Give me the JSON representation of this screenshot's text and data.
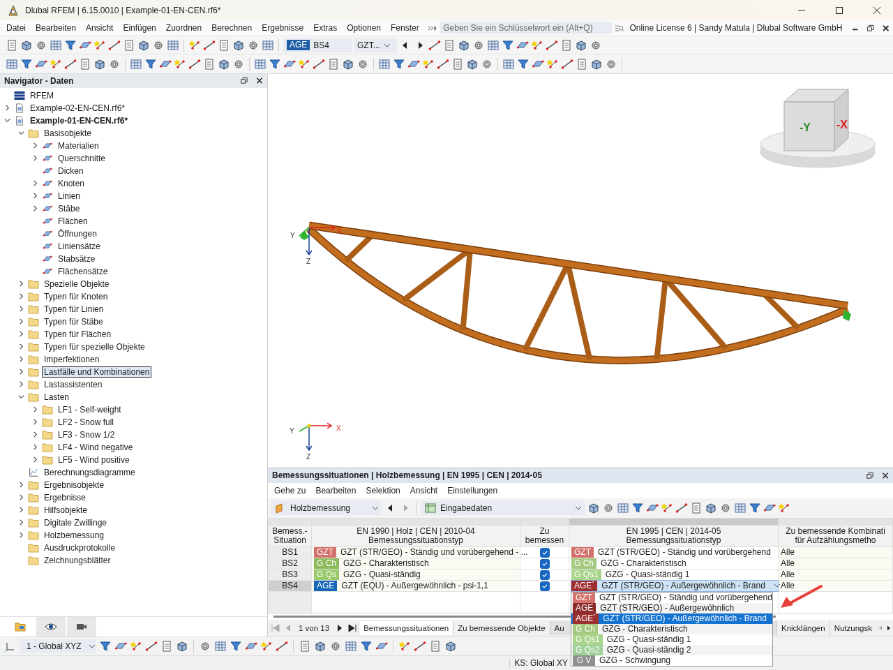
{
  "window": {
    "title": "Dlubal RFEM | 6.15.0010 | Example-01-EN-CEN.rf6*"
  },
  "menu": [
    "Datei",
    "Bearbeiten",
    "Ansicht",
    "Einfügen",
    "Zuordnen",
    "Berechnen",
    "Ergebnisse",
    "Extras",
    "Optionen",
    "Fenster"
  ],
  "search": {
    "placeholder": "Geben Sie ein Schlüsselwort ein (Alt+Q)"
  },
  "license": "Online License 6 | Sandy Matula | Dlubal Software GmbH",
  "toolbar": {
    "situation_badge": {
      "label": "AGE",
      "color": "#1e5fa8"
    },
    "situation": "BS4",
    "combo": "GZT..."
  },
  "navigator": {
    "title": "Navigator - Daten",
    "tree": [
      {
        "label": "RFEM",
        "kind": "root",
        "selected": false
      },
      {
        "label": "Example-02-EN-CEN.rf6*",
        "kind": "file",
        "expanded": false,
        "selected": false
      },
      {
        "label": "Example-01-EN-CEN.rf6*",
        "kind": "file",
        "expanded": true,
        "selected": false,
        "children": [
          {
            "label": "Basisobjekte",
            "kind": "folder",
            "expanded": true,
            "selected": false,
            "children": [
              {
                "label": "Materialien",
                "kind": "object",
                "expanded": false,
                "selected": false
              },
              {
                "label": "Querschnitte",
                "kind": "object",
                "expanded": false,
                "selected": false
              },
              {
                "label": "Dicken",
                "kind": "object",
                "selected": false
              },
              {
                "label": "Knoten",
                "kind": "object",
                "expanded": false,
                "selected": false
              },
              {
                "label": "Linien",
                "kind": "object",
                "expanded": false,
                "selected": false
              },
              {
                "label": "Stäbe",
                "kind": "object",
                "expanded": false,
                "selected": false
              },
              {
                "label": "Flächen",
                "kind": "object",
                "selected": false
              },
              {
                "label": "Öffnungen",
                "kind": "object",
                "selected": false
              },
              {
                "label": "Liniensätze",
                "kind": "object",
                "selected": false
              },
              {
                "label": "Stabsätze",
                "kind": "object",
                "selected": false
              },
              {
                "label": "Flächensätze",
                "kind": "object",
                "selected": false
              }
            ]
          },
          {
            "label": "Spezielle Objekte",
            "kind": "folder",
            "expanded": false,
            "selected": false
          },
          {
            "label": "Typen für Knoten",
            "kind": "folder",
            "expanded": false,
            "selected": false
          },
          {
            "label": "Typen für Linien",
            "kind": "folder",
            "expanded": false,
            "selected": false
          },
          {
            "label": "Typen für Stäbe",
            "kind": "folder",
            "expanded": false,
            "selected": false
          },
          {
            "label": "Typen für Flächen",
            "kind": "folder",
            "expanded": false,
            "selected": false
          },
          {
            "label": "Typen für spezielle Objekte",
            "kind": "folder",
            "expanded": false,
            "selected": false
          },
          {
            "label": "Imperfektionen",
            "kind": "folder",
            "expanded": false,
            "selected": false
          },
          {
            "label": "Lastfälle und Kombinationen",
            "kind": "folder",
            "expanded": false,
            "selected": true
          },
          {
            "label": "Lastassistenten",
            "kind": "folder",
            "expanded": false,
            "selected": false
          },
          {
            "label": "Lasten",
            "kind": "folder",
            "expanded": true,
            "selected": false,
            "children": [
              {
                "label": "LF1 - Self-weight",
                "kind": "folder",
                "expanded": false,
                "selected": false
              },
              {
                "label": "LF2 - Snow full",
                "kind": "folder",
                "expanded": false,
                "selected": false
              },
              {
                "label": "LF3 - Snow 1/2",
                "kind": "folder",
                "expanded": false,
                "selected": false
              },
              {
                "label": "LF4 - Wind negative",
                "kind": "folder",
                "expanded": false,
                "selected": false
              },
              {
                "label": "LF5 - Wind positive",
                "kind": "folder",
                "expanded": false,
                "selected": false
              }
            ]
          },
          {
            "label": "Berechnungsdiagramme",
            "kind": "diagram",
            "selected": false
          },
          {
            "label": "Ergebnisobjekte",
            "kind": "folder",
            "expanded": false,
            "selected": false
          },
          {
            "label": "Ergebnisse",
            "kind": "folder",
            "expanded": false,
            "selected": false
          },
          {
            "label": "Hilfsobjekte",
            "kind": "folder",
            "expanded": false,
            "selected": false
          },
          {
            "label": "Digitale Zwillinge",
            "kind": "folder",
            "expanded": false,
            "selected": false
          },
          {
            "label": "Holzbemessung",
            "kind": "folder",
            "expanded": false,
            "selected": false
          },
          {
            "label": "Ausdruckprotokolle",
            "kind": "folder",
            "selected": false
          },
          {
            "label": "Zeichnungsblätter",
            "kind": "folder",
            "selected": false
          }
        ]
      }
    ],
    "tabs": [
      {
        "selected": true
      },
      {
        "selected": false
      },
      {
        "selected": false
      }
    ]
  },
  "viewport": {
    "axes_main": [
      "Y",
      "X",
      "Z"
    ],
    "axes_corner": [
      "Y",
      "X",
      "Z"
    ],
    "view_cube": [
      "-Y",
      "-X"
    ]
  },
  "panel": {
    "title": "Bemessungssituationen | Holzbemessung | EN 1995 | CEN | 2014-05",
    "menu": [
      "Gehe zu",
      "Bearbeiten",
      "Selektion",
      "Ansicht",
      "Einstellungen"
    ],
    "module_combo": "Holzbemessung",
    "data_combo": "Eingabedaten",
    "columns": [
      {
        "lines": [
          "Bemess.-",
          "Situation"
        ]
      },
      {
        "lines": [
          "EN 1990 | Holz | CEN | 2010-04",
          "Bemessungssituationstyp"
        ]
      },
      {
        "lines": [
          "Zu",
          "bemessen"
        ]
      },
      {
        "lines": [
          "EN 1995 | CEN | 2014-05",
          "Bemessungssituationstyp"
        ]
      },
      {
        "lines": [
          "Zu bemessende Kombinati",
          "für Aufzählungsmetho"
        ]
      }
    ],
    "rows": [
      {
        "id": "BS1",
        "selected": false,
        "en1990": {
          "badge": "GZT",
          "color": "#d4716b",
          "text": "GZT (STR/GEO) - Ständig und vorübergehend - ..."
        },
        "design": true,
        "en1995": {
          "badge": "GZT",
          "color": "#d4716b",
          "text": "GZT (STR/GEO) - Ständig und vorübergehend",
          "editing": false
        },
        "combos": "Alle"
      },
      {
        "id": "BS2",
        "selected": false,
        "en1990": {
          "badge": "G Ch",
          "color": "#8dbb5c",
          "text": "GZG - Charakteristisch"
        },
        "design": true,
        "en1995": {
          "badge": "G Ch",
          "color": "#a5c97f",
          "text": "GZG - Charakteristisch",
          "editing": false
        },
        "combos": "Alle"
      },
      {
        "id": "BS3",
        "selected": false,
        "en1990": {
          "badge": "G Qs",
          "color": "#98c96a",
          "text": "GZG - Quasi-ständig"
        },
        "design": true,
        "en1995": {
          "badge": "G Qs1",
          "color": "#a9d48b",
          "text": "GZG - Quasi-ständig 1",
          "editing": false
        },
        "combos": "Alle"
      },
      {
        "id": "BS4",
        "selected": true,
        "en1990": {
          "badge": "AGE",
          "color": "#1565b8",
          "text": "GZT (EQU) - Außergewöhnlich - psi-1,1"
        },
        "design": true,
        "en1995": {
          "badge": "AGE´",
          "color": "#9e2f2f",
          "text": "GZT (STR/GEO) - Außergewöhnlich - Brand",
          "editing": true
        },
        "combos": "Alle"
      }
    ],
    "dropdown": [
      {
        "badge": "GZT",
        "color": "#d4716b",
        "text": "GZT (STR/GEO) - Ständig und vorübergehend",
        "selected": false
      },
      {
        "badge": "AGE",
        "color": "#8b2a2a",
        "text": "GZT (STR/GEO) - Außergewöhnlich",
        "selected": false
      },
      {
        "badge": "AGE´",
        "color": "#9e2f2f",
        "text": "GZT (STR/GEO) - Außergewöhnlich - Brand",
        "selected": true
      },
      {
        "badge": "G Ch",
        "color": "#a5c97f",
        "text": "GZG - Charakteristisch",
        "selected": false
      },
      {
        "badge": "G Qs1",
        "color": "#a9d48b",
        "text": "GZG - Quasi-ständig 1",
        "selected": false
      },
      {
        "badge": "G Qs2",
        "color": "#9fd09a",
        "text": "GZG - Quasi-ständig 2",
        "selected": false
      },
      {
        "badge": "G V",
        "color": "#8f8f8f",
        "text": "GZG - Schwingung",
        "selected": false
      }
    ],
    "pager": "1 von 13",
    "tabs": [
      {
        "label": "Bemessungssituationen",
        "selected": true
      },
      {
        "label": "Zu bemessende Objekte",
        "selected": false
      },
      {
        "label": "Au",
        "selected": false
      },
      {
        "label": "Knicklängen",
        "selected": false
      },
      {
        "label": "Nutzungsk",
        "selected": false
      }
    ]
  },
  "bottom_toolbar": {
    "coordinate_system": "1 - Global XYZ"
  },
  "status": {
    "coordinate_system": "KS: Global XY"
  }
}
